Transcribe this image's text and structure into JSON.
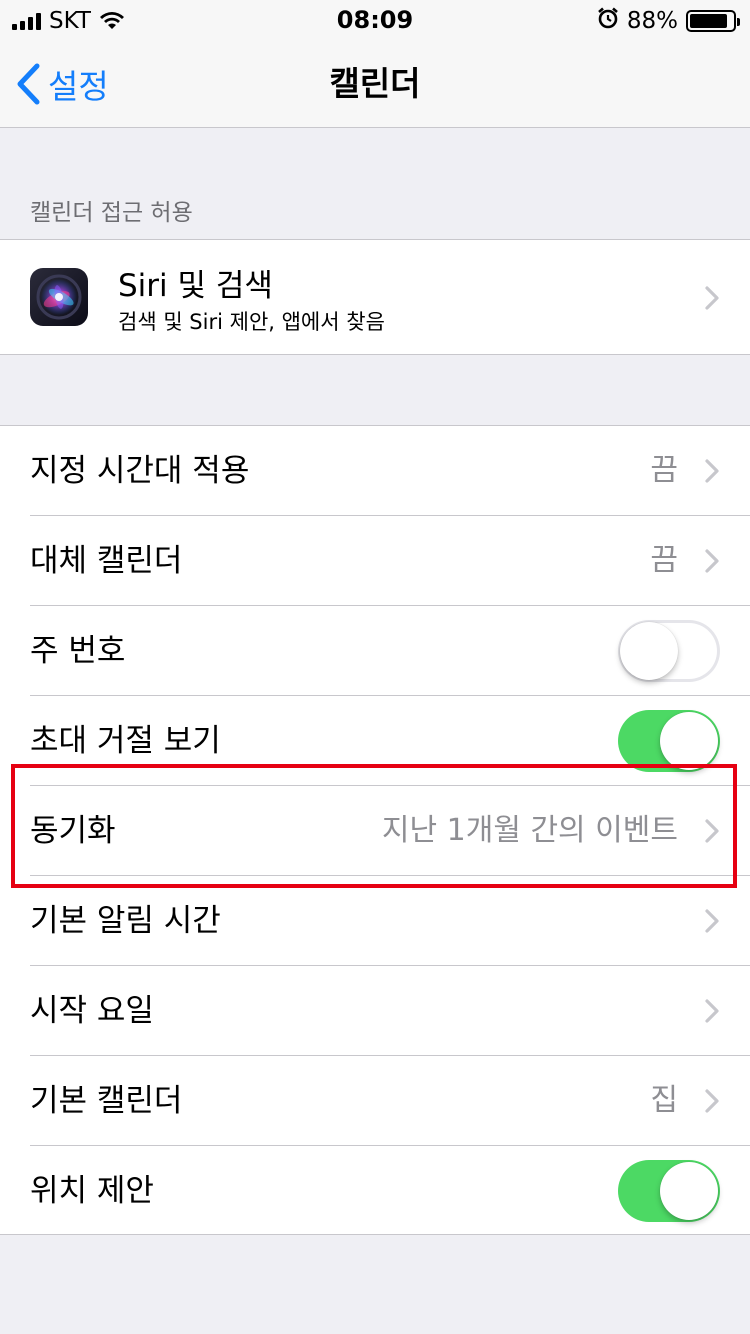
{
  "status_bar": {
    "carrier": "SKT",
    "time": "08:09",
    "battery_percent": "88%",
    "battery_level": 0.88,
    "icons": [
      "signal-icon",
      "wifi-icon",
      "alarm-icon",
      "battery-icon"
    ]
  },
  "nav": {
    "back_label": "설정",
    "title": "캘린더"
  },
  "section_header": "캘린더 접근 허용",
  "siri_row": {
    "title": "Siri 및 검색",
    "subtitle": "검색 및 Siri 제안, 앱에서 찾음"
  },
  "rows": [
    {
      "label": "지정 시간대 적용",
      "value": "끔",
      "type": "disclosure"
    },
    {
      "label": "대체 캘린더",
      "value": "끔",
      "type": "disclosure"
    },
    {
      "label": "주 번호",
      "type": "toggle",
      "on": false
    },
    {
      "label": "초대 거절 보기",
      "type": "toggle",
      "on": true
    },
    {
      "label": "동기화",
      "value": "지난 1개월 간의 이벤트",
      "type": "disclosure"
    },
    {
      "label": "기본 알림 시간",
      "value": "",
      "type": "disclosure"
    },
    {
      "label": "시작 요일",
      "value": "",
      "type": "disclosure"
    },
    {
      "label": "기본 캘린더",
      "value": "집",
      "type": "disclosure"
    },
    {
      "label": "위치 제안",
      "type": "toggle",
      "on": true
    }
  ],
  "colors": {
    "accent": "#147efb",
    "toggle_on": "#4cd964",
    "highlight": "#e60012",
    "background": "#efeff4"
  }
}
